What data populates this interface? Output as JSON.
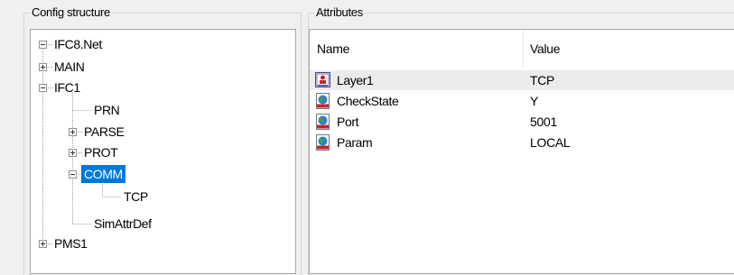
{
  "config_title": "Config structure",
  "attributes_title": "Attributes",
  "tree": {
    "root": "IFC8.Net",
    "main": "MAIN",
    "ifc1": "IFC1",
    "prn": "PRN",
    "parse": "PARSE",
    "prot": "PROT",
    "comm": "COMM",
    "tcp": "TCP",
    "simattrdef": "SimAttrDef",
    "pms1": "PMS1"
  },
  "list": {
    "columns": [
      "Name",
      "Value"
    ],
    "rows": [
      {
        "name": "Layer1",
        "value": "TCP",
        "icon": "layer-icon"
      },
      {
        "name": "CheckState",
        "value": "Y",
        "icon": "globe-document-icon"
      },
      {
        "name": "Port",
        "value": "5001",
        "icon": "globe-document-icon"
      },
      {
        "name": "Param",
        "value": "LOCAL",
        "icon": "globe-document-icon"
      }
    ]
  },
  "colors": {
    "selection": "#0078d7",
    "highlight_row": "#ececec"
  }
}
